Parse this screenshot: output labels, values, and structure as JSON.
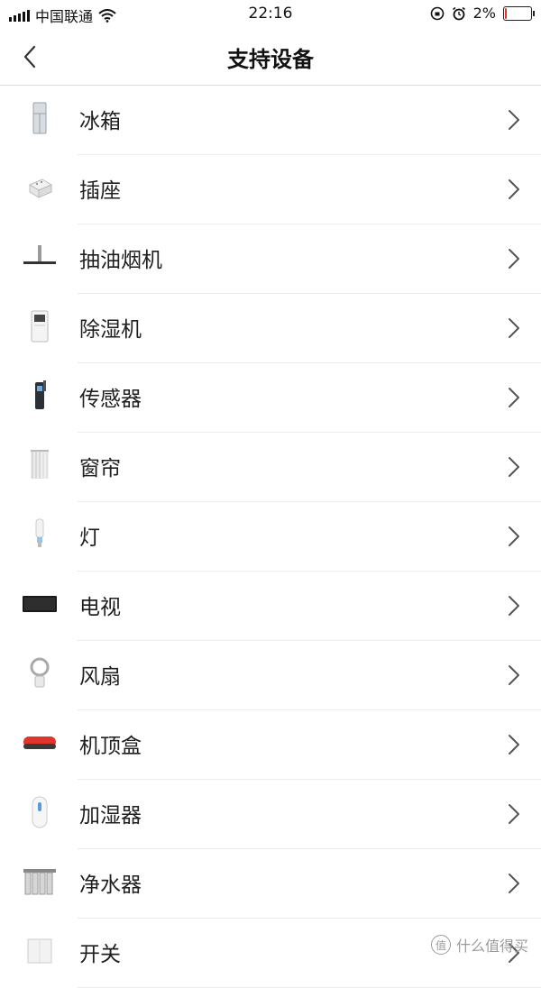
{
  "status_bar": {
    "carrier": "中国联通",
    "time": "22:16",
    "battery": "2%",
    "battery_level": 0.02,
    "wifi_icon": "wifi-icon",
    "alarm_icon": "alarm-icon",
    "lock_rotation_icon": "lock-rotation-icon"
  },
  "nav": {
    "title": "支持设备",
    "back_icon": "chevron-left-icon"
  },
  "devices": [
    {
      "label": "冰箱",
      "icon": "fridge-icon"
    },
    {
      "label": "插座",
      "icon": "power-strip-icon"
    },
    {
      "label": "抽油烟机",
      "icon": "range-hood-icon"
    },
    {
      "label": "除湿机",
      "icon": "dehumidifier-icon"
    },
    {
      "label": "传感器",
      "icon": "sensor-icon"
    },
    {
      "label": "窗帘",
      "icon": "curtain-icon"
    },
    {
      "label": "灯",
      "icon": "bulb-icon"
    },
    {
      "label": "电视",
      "icon": "tv-icon"
    },
    {
      "label": "风扇",
      "icon": "fan-icon"
    },
    {
      "label": "机顶盒",
      "icon": "set-top-box-icon"
    },
    {
      "label": "加湿器",
      "icon": "humidifier-icon"
    },
    {
      "label": "净水器",
      "icon": "water-purifier-icon"
    },
    {
      "label": "开关",
      "icon": "wall-switch-icon"
    }
  ],
  "watermark": {
    "badge": "值",
    "text": "什么值得买"
  },
  "colors": {
    "accent_red": "#e0352b",
    "divider": "#ececec",
    "chevron": "#555555"
  }
}
